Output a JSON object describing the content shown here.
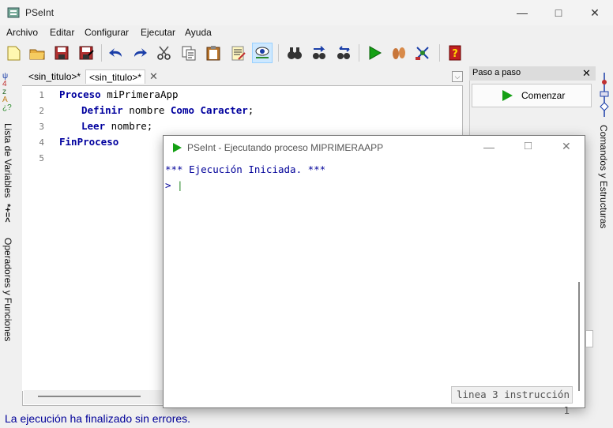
{
  "window": {
    "title": "PSeInt"
  },
  "menu": [
    "Archivo",
    "Editar",
    "Configurar",
    "Ejecutar",
    "Ayuda"
  ],
  "toolbar": {
    "icons": [
      "new-file-icon",
      "open-folder-icon",
      "save-icon",
      "save-as-icon",
      "undo-icon",
      "redo-icon",
      "cut-icon",
      "copy-icon",
      "paste-icon",
      "edit-text-icon",
      "inspect-eye-icon",
      "search-binoculars-icon",
      "search-next-icon",
      "replace-icon",
      "run-icon",
      "step-run-icon",
      "flow-diagram-icon",
      "help-icon"
    ]
  },
  "left_strip": {
    "variables_label": "Lista de Variables",
    "operators_label": "Operadores y Funciones",
    "operators_symbols": "*+=<"
  },
  "tabs": [
    {
      "label": "<sin_titulo>*"
    },
    {
      "label": "<sin_titulo>*"
    }
  ],
  "editor": {
    "line_numbers": [
      "1",
      "2",
      "3",
      "4",
      "5"
    ],
    "lines": [
      {
        "k1": "Proceso",
        "t1": " miPrimeraApp"
      },
      {
        "k1": "Definir",
        "t1": " nombre ",
        "k2": "Como Caracter",
        "t2": ";"
      },
      {
        "k1": "Leer",
        "t1": " nombre;"
      },
      {
        "k1": "FinProceso"
      }
    ]
  },
  "right_panel": {
    "header": "Paso a paso",
    "start_button": "Comenzar"
  },
  "right_strip": {
    "label": "Comandos y Estructuras"
  },
  "status": {
    "text": "La ejecución ha finalizado sin errores."
  },
  "console": {
    "title": "PSeInt - Ejecutando proceso MIPRIMERAAPP",
    "started": "*** Ejecución Iniciada. ***",
    "prompt": ">",
    "status": "linea 3 instrucción 1"
  }
}
